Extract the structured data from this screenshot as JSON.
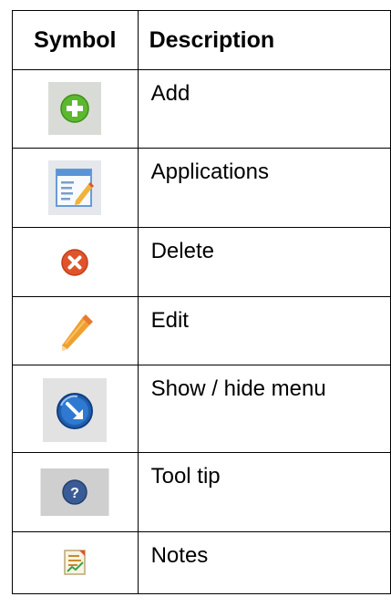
{
  "table": {
    "headers": {
      "symbol": "Symbol",
      "description": "Description"
    },
    "rows": [
      {
        "description": "Add",
        "icon": "add-icon"
      },
      {
        "description": "Applications",
        "icon": "applications-icon"
      },
      {
        "description": "Delete",
        "icon": "delete-icon"
      },
      {
        "description": "Edit",
        "icon": "edit-pencil-icon"
      },
      {
        "description": "Show / hide menu",
        "icon": "show-hide-menu-icon"
      },
      {
        "description": "Tool tip",
        "icon": "tooltip-help-icon"
      },
      {
        "description": "Notes",
        "icon": "notes-icon"
      }
    ]
  },
  "colors": {
    "add_green": "#5cb82e",
    "delete_red": "#e0542c",
    "menu_blue": "#1f5fb0",
    "tooltip_blue": "#3a5c96",
    "pencil_orange": "#f0a030",
    "icon_bg_gray": "#d6d6d6"
  }
}
